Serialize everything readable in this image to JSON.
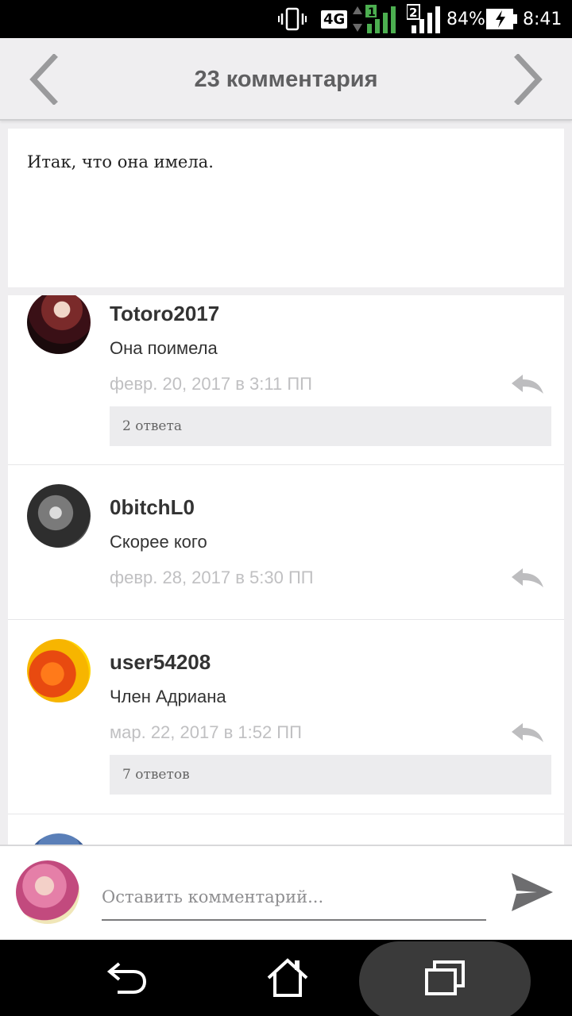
{
  "status_bar": {
    "network": "4G",
    "sim1": "1",
    "sim2": "2",
    "battery": "84%",
    "time": "8:41",
    "icons": [
      "vibrate-icon",
      "signal-icon",
      "battery-icon"
    ]
  },
  "header": {
    "title": "23 комментария",
    "prev_icon": "chevron-left-icon",
    "next_icon": "chevron-right-icon"
  },
  "post": {
    "text": "Итак, что она имела."
  },
  "comments": [
    {
      "username": "Totoro2017",
      "text": "Она поимела",
      "date": "февр. 20, 2017 в 3:11 ПП",
      "replies": "2 ответа"
    },
    {
      "username": "0bitchL0",
      "text": "Скорее кого",
      "date": "февр. 28, 2017 в 5:30 ПП",
      "replies": ""
    },
    {
      "username": "user54208",
      "text": "Член Адриана",
      "date": "мар. 22, 2017 в 1:52 ПП",
      "replies": "7 ответов"
    }
  ],
  "composer": {
    "placeholder": "Оставить комментарий..."
  },
  "colors": {
    "accent_text": "#5f5f61",
    "date_text": "#c0c0c2",
    "background": "#efeef0"
  }
}
